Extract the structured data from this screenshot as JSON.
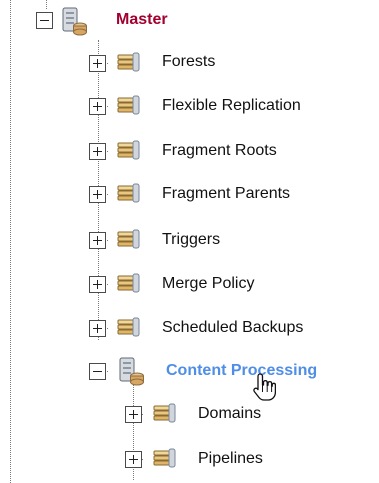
{
  "tree": {
    "root": {
      "label": "Master",
      "icon": "server-database-icon",
      "expanded": true
    },
    "children": [
      {
        "label": "Forests",
        "icon": "stack-folder-icon",
        "expanded": false
      },
      {
        "label": "Flexible Replication",
        "icon": "stack-folder-icon",
        "expanded": false
      },
      {
        "label": "Fragment Roots",
        "icon": "stack-folder-icon",
        "expanded": false
      },
      {
        "label": "Fragment Parents",
        "icon": "stack-folder-icon",
        "expanded": false
      },
      {
        "label": "Triggers",
        "icon": "stack-folder-icon",
        "expanded": false
      },
      {
        "label": "Merge Policy",
        "icon": "stack-folder-icon",
        "expanded": false
      },
      {
        "label": "Scheduled Backups",
        "icon": "stack-folder-icon",
        "expanded": false
      },
      {
        "label": "Content Processing",
        "icon": "server-database-icon",
        "expanded": true,
        "hovered": true,
        "children": [
          {
            "label": "Domains",
            "icon": "stack-folder-icon",
            "expanded": false
          },
          {
            "label": "Pipelines",
            "icon": "stack-folder-icon",
            "expanded": false
          }
        ]
      }
    ]
  },
  "cursor": {
    "icon": "hand-pointer-icon"
  },
  "colors": {
    "root_label": "#a3002f",
    "selected_label": "#4f8ee6",
    "guide": "#7a7a7a"
  }
}
